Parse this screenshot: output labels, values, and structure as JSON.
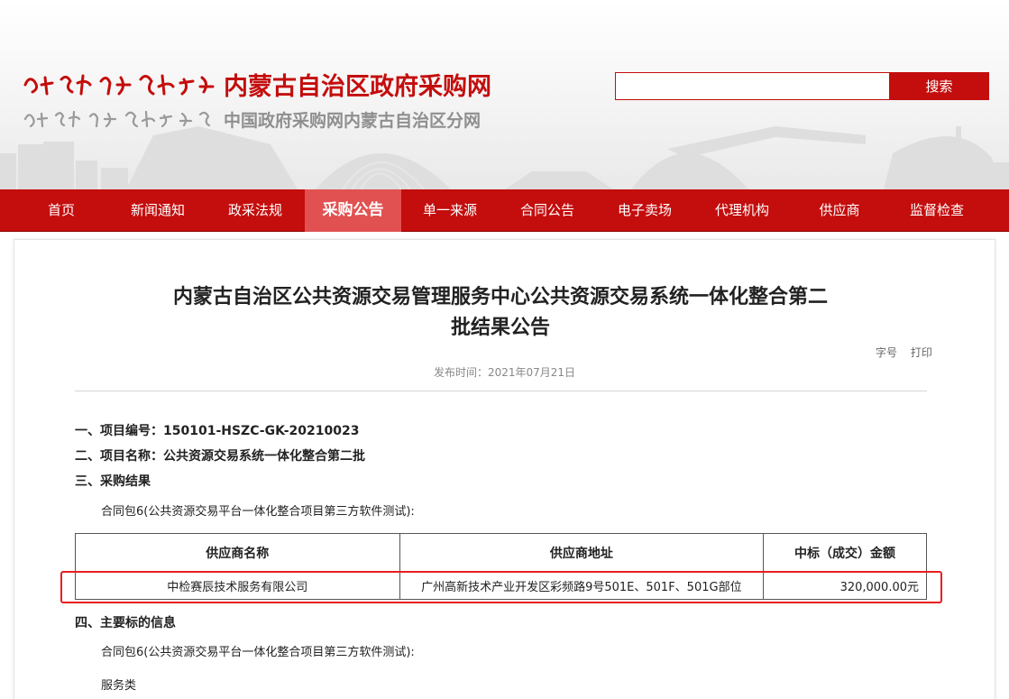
{
  "header": {
    "site_title": "内蒙古自治区政府采购网",
    "site_subtitle": "中国政府采购网内蒙古自治区分网",
    "search_placeholder": "",
    "search_button": "搜索"
  },
  "nav": {
    "items": [
      "首页",
      "新闻通知",
      "政采法规",
      "采购公告",
      "单一来源",
      "合同公告",
      "电子卖场",
      "代理机构",
      "供应商",
      "监督检查"
    ],
    "active_index": 3
  },
  "article": {
    "title_line1": "内蒙古自治区公共资源交易管理服务中心公共资源交易系统一体化整合第二",
    "title_line2": "批结果公告",
    "font_size_label": "字号",
    "print_label": "打印",
    "pubdate": "发布时间：2021年07月21日",
    "sec1": "一、项目编号：150101-HSZC-GK-20210023",
    "sec2": "二、项目名称：公共资源交易系统一体化整合第二批",
    "sec3": "三、采购结果",
    "package_line": "合同包6(公共资源交易平台一体化整合项目第三方软件测试):",
    "table_headers": [
      "供应商名称",
      "供应商地址",
      "中标（成交）金额"
    ],
    "table_rows": [
      [
        "中检赛辰技术服务有限公司",
        "广州高新技术产业开发区彩频路9号501E、501F、501G部位",
        "320,000.00元"
      ]
    ],
    "sec4": "四、主要标的信息",
    "package_line2": "合同包6(公共资源交易平台一体化整合项目第三方软件测试):",
    "service_type": "服务类"
  },
  "colors": {
    "brand_red": "#c40d0d",
    "nav_active": "#e15151",
    "highlight_red": "#e81f1f"
  }
}
